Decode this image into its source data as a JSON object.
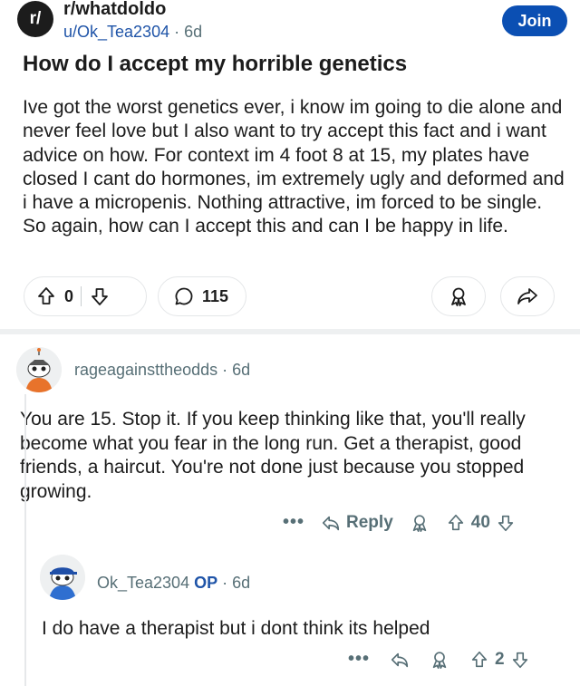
{
  "post": {
    "subreddit": "r/whatdoldo",
    "author": "u/Ok_Tea2304",
    "age": "6d",
    "join_label": "Join",
    "title": "How do I accept my horrible genetics",
    "body": "Ive got the worst genetics ever, i know im going to die alone and never feel love but I also want to try accept this fact and i want advice on how. For context im 4 foot 8 at 15, my plates have closed I cant do hormones, im extremely ugly and deformed and i have a micropenis. Nothing attractive, im forced to be single. So again, how can I accept this and can I be happy in life.",
    "votes": "0",
    "comments": "115",
    "sub_icon_text": "r/"
  },
  "comments": [
    {
      "author": "rageagainsttheodds",
      "age": "6d",
      "text": "You are 15. Stop it. If you keep thinking like that, you'll really become what you fear in the long run. Get a therapist, good friends, a haircut. You're not done just because you stopped growing.",
      "more": "•••",
      "reply_label": "Reply",
      "votes": "40"
    },
    {
      "author": "Ok_Tea2304",
      "op_badge": "OP",
      "age": "6d",
      "text": "I do have a therapist but i dont think its helped",
      "more": "•••",
      "votes": "2"
    }
  ],
  "colors": {
    "join": "#0b4fb3",
    "meta": "#576f76",
    "link": "#1f54a8"
  },
  "icons": [
    "upvote-icon",
    "downvote-icon",
    "comment-icon",
    "award-icon",
    "share-icon",
    "reply-icon",
    "more-icon"
  ]
}
